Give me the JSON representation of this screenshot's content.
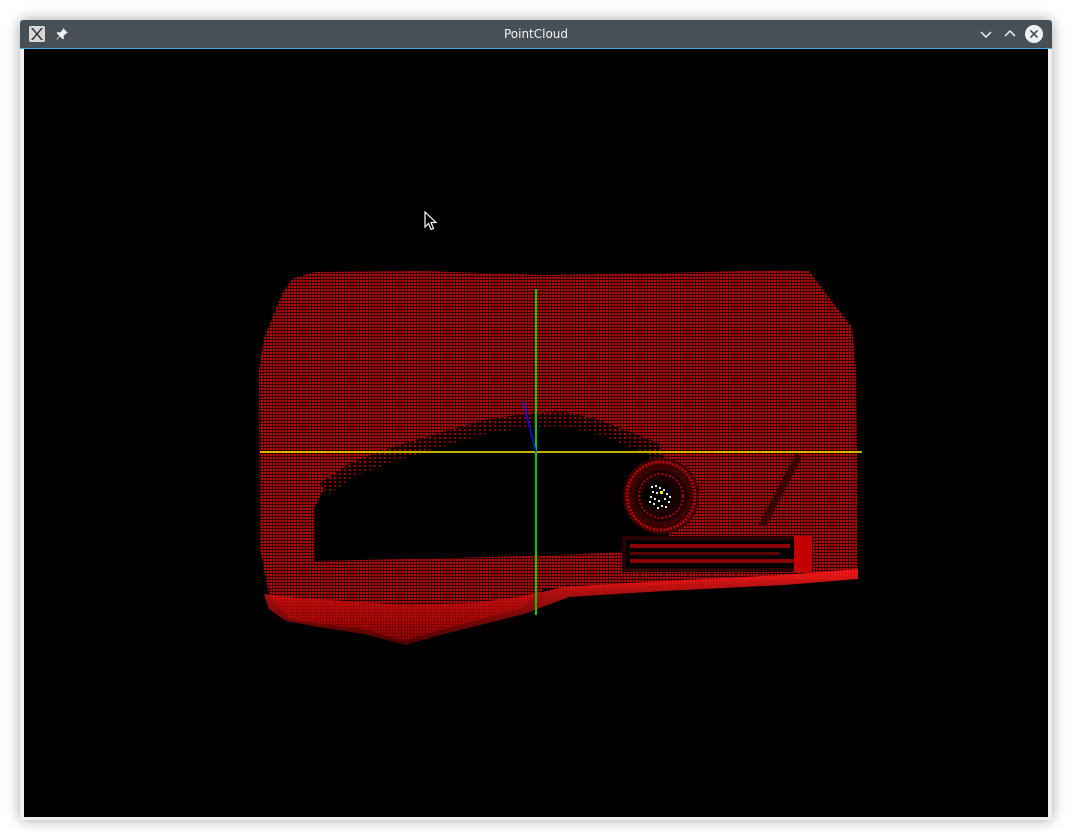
{
  "window": {
    "title": "PointCloud",
    "app_icon": "x11-app-icon",
    "pin_icon": "pin-icon",
    "controls": [
      "minimize-icon",
      "maximize-icon",
      "close-icon"
    ]
  },
  "viewport": {
    "background": "#000000",
    "cloud_color": "#cc0000",
    "axis_colors": {
      "x": "#ffee00",
      "y": "#00cc00",
      "z": "#0000ff"
    }
  }
}
